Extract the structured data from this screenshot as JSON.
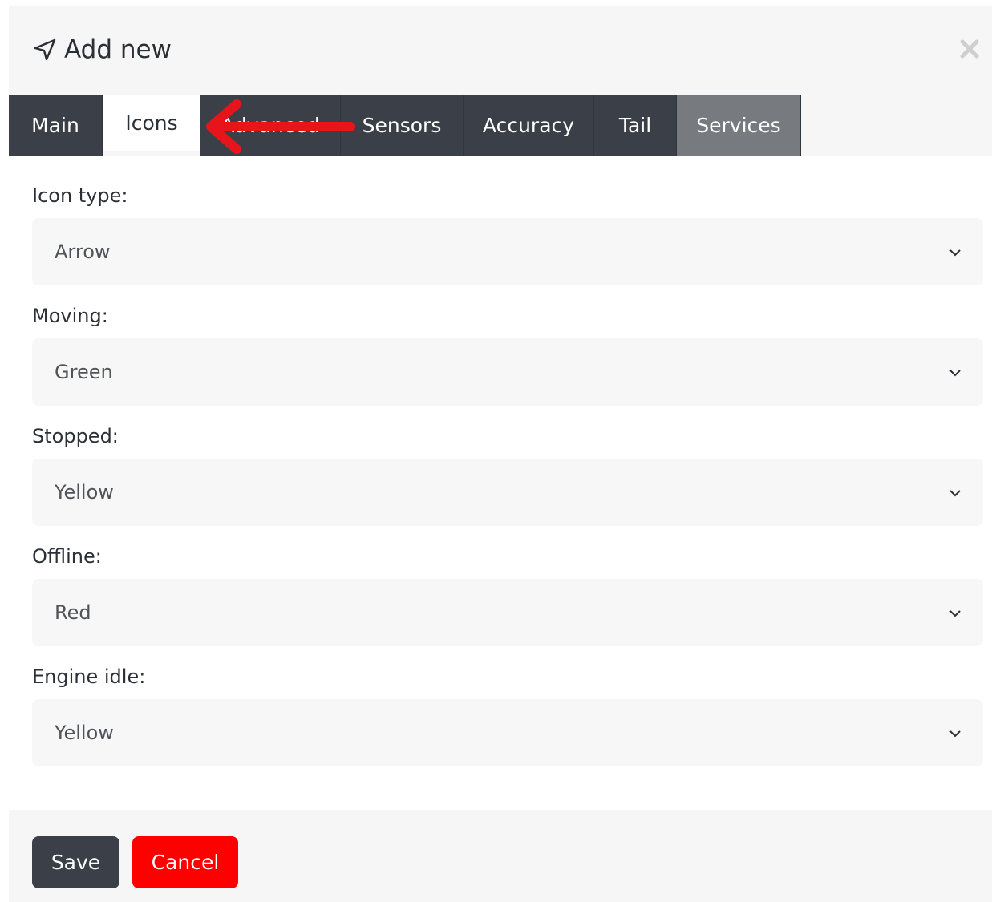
{
  "modal": {
    "title": "Add new",
    "header_icon": "send-icon",
    "close_icon": "close-icon"
  },
  "tabs": [
    {
      "label": "Main"
    },
    {
      "label": "Icons",
      "active": true
    },
    {
      "label": "Advanced"
    },
    {
      "label": "Sensors"
    },
    {
      "label": "Accuracy"
    },
    {
      "label": "Tail"
    },
    {
      "label": "Services"
    }
  ],
  "form": {
    "fields": [
      {
        "label": "Icon type:",
        "value": "Arrow"
      },
      {
        "label": "Moving:",
        "value": "Green"
      },
      {
        "label": "Stopped:",
        "value": "Yellow"
      },
      {
        "label": "Offline:",
        "value": "Red"
      },
      {
        "label": "Engine idle:",
        "value": "Yellow"
      }
    ]
  },
  "footer": {
    "save_label": "Save",
    "cancel_label": "Cancel"
  },
  "colors": {
    "tab_bg": "#3b4048",
    "tab_services_bg": "#777b80",
    "save_bg": "#3b4048",
    "cancel_bg": "#ff0000",
    "annotation_arrow": "#e8141c"
  }
}
